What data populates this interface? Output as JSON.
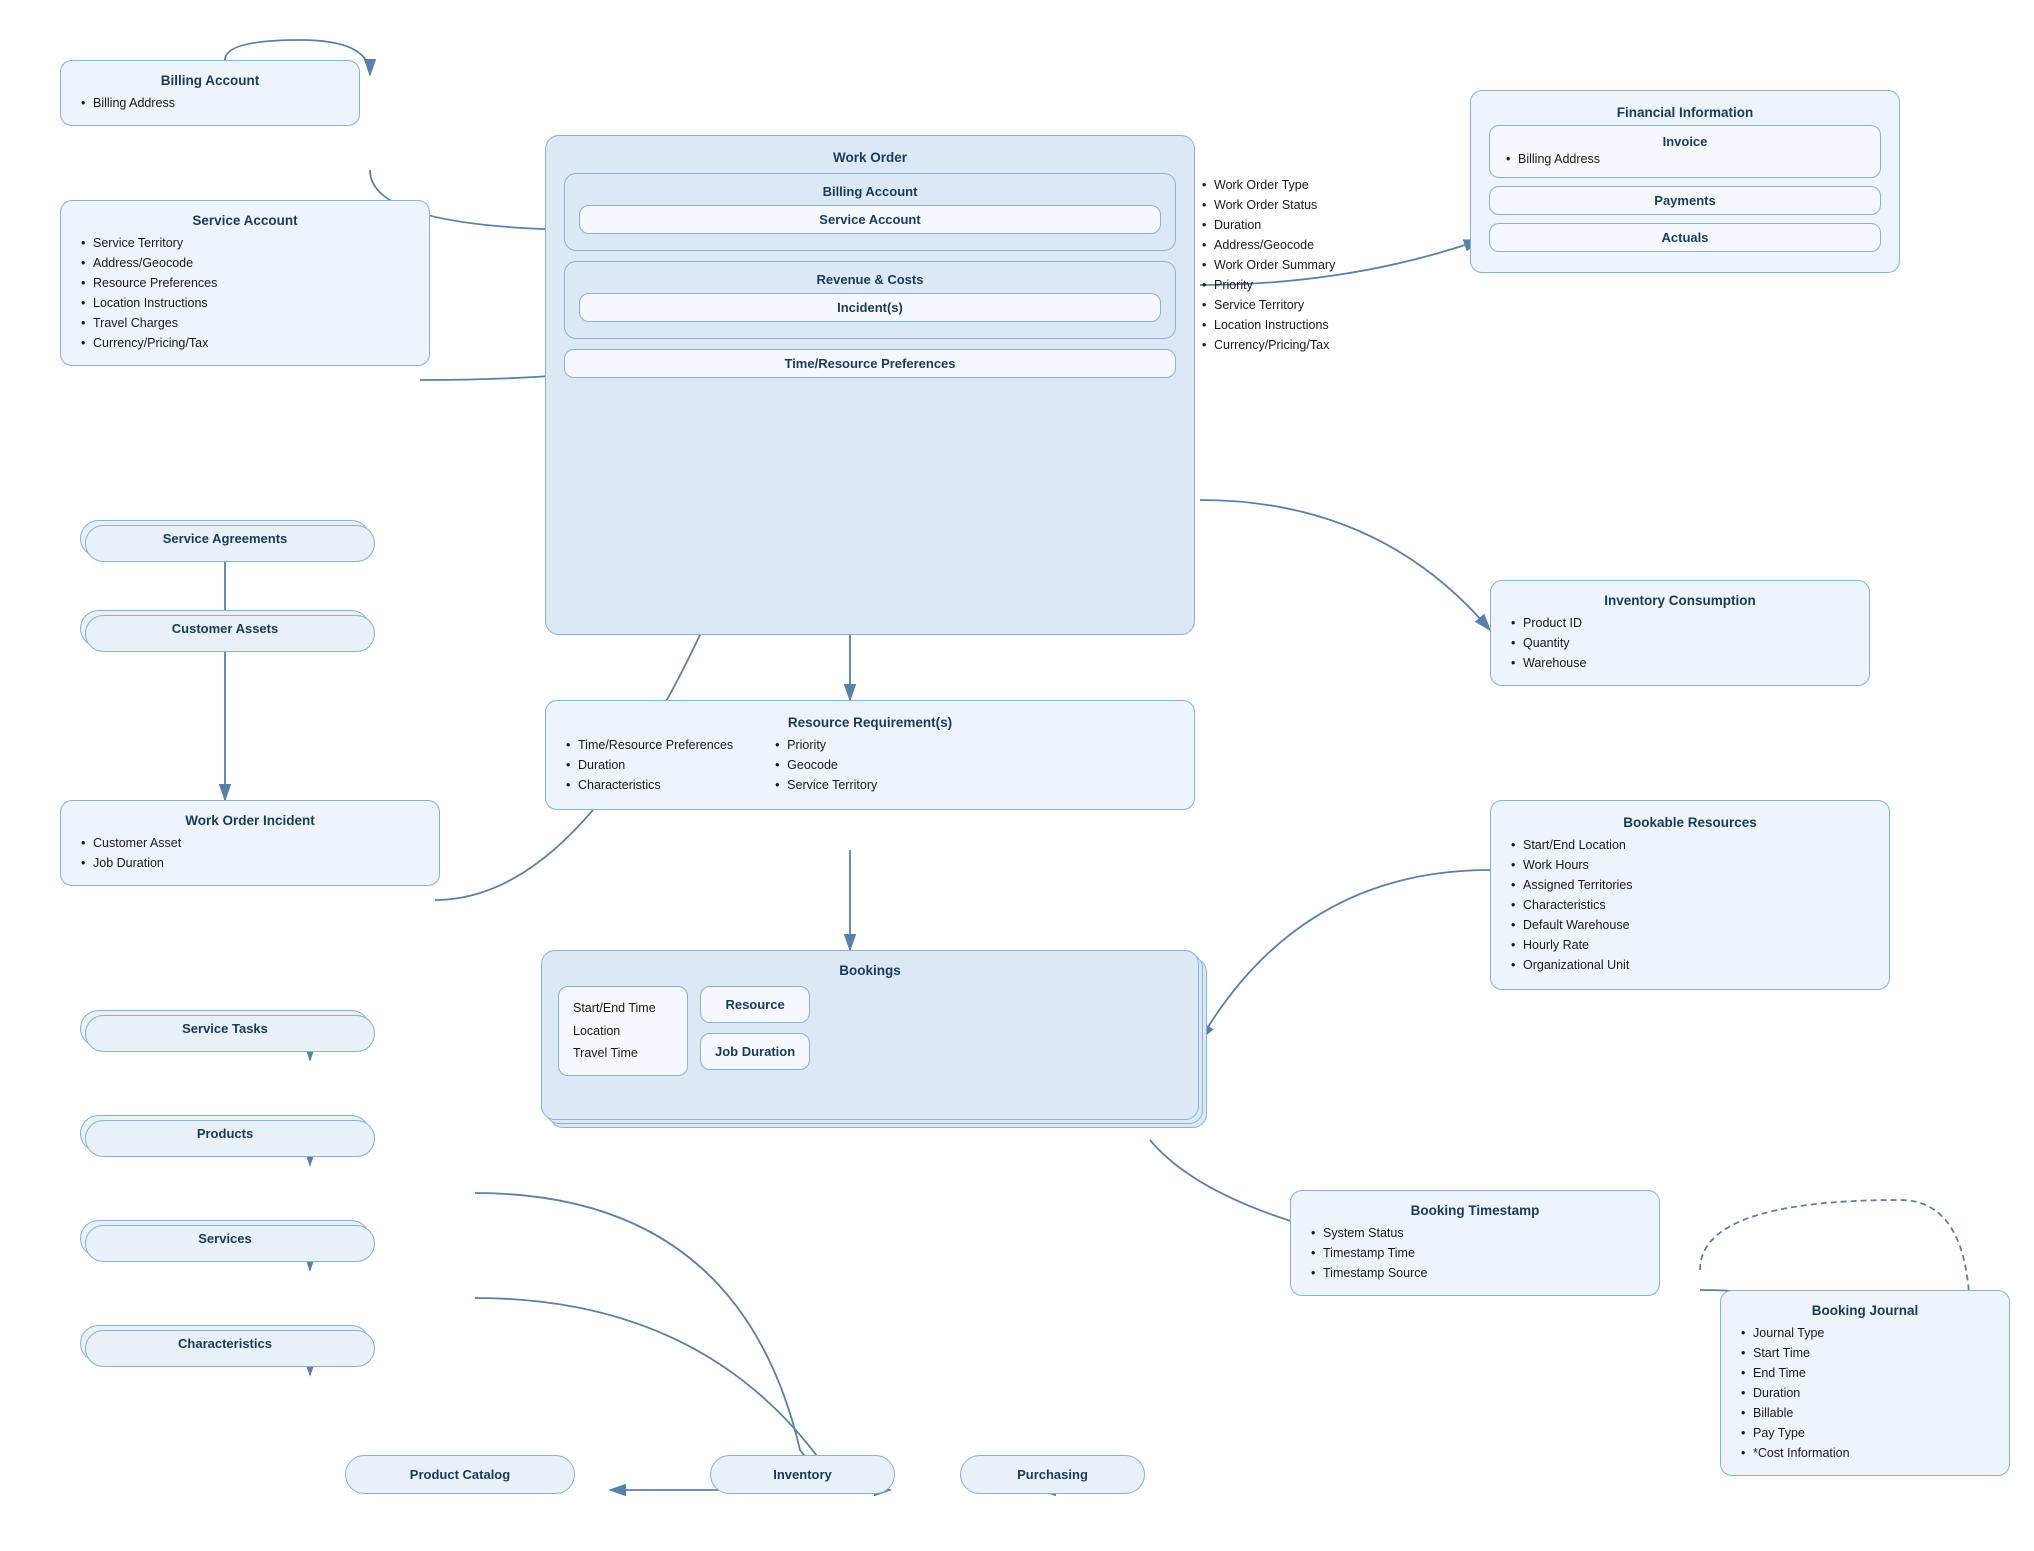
{
  "billing_account_top": {
    "title": "Billing Account",
    "items": [
      "Billing Address"
    ]
  },
  "service_account": {
    "title": "Service Account",
    "items": [
      "Service Territory",
      "Address/Geocode",
      "Resource Preferences",
      "Location Instructions",
      "Travel Charges",
      "Currency/Pricing/Tax"
    ]
  },
  "service_agreements": "Service Agreements",
  "customer_assets": "Customer Assets",
  "work_order_incident": {
    "title": "Work Order Incident",
    "items": [
      "Customer Asset",
      "Job Duration"
    ]
  },
  "service_tasks": "Service Tasks",
  "products": "Products",
  "services": "Services",
  "characteristics": "Characteristics",
  "product_catalog": "Product Catalog",
  "inventory": "Inventory",
  "purchasing": "Purchasing",
  "work_order_outer_title": "Work Order",
  "work_order_billing_account": "Billing Account",
  "work_order_service_account": "Service Account",
  "work_order_revenue_costs": "Revenue & Costs",
  "work_order_incidents": "Incident(s)",
  "work_order_time_resource": "Time/Resource Preferences",
  "work_order_fields": [
    "Work Order Type",
    "Work Order Status",
    "Duration",
    "Address/Geocode",
    "Work Order Summary",
    "Priority",
    "Service Territory",
    "Location Instructions",
    "Currency/Pricing/Tax"
  ],
  "resource_requirements": {
    "title": "Resource Requirement(s)",
    "col1": [
      "Time/Resource Preferences",
      "Duration",
      "Characteristics"
    ],
    "col2": [
      "Priority",
      "Geocode",
      "Service Territory"
    ]
  },
  "bookings": {
    "title": "Bookings",
    "left": [
      "Start/End Time",
      "Location",
      "Travel Time"
    ],
    "resource": "Resource",
    "job_duration": "Job Duration"
  },
  "financial_information": {
    "title": "Financial Information",
    "invoice_title": "Invoice",
    "invoice_items": [
      "Billing Address"
    ],
    "payments": "Payments",
    "actuals": "Actuals"
  },
  "inventory_consumption": {
    "title": "Inventory Consumption",
    "items": [
      "Product ID",
      "Quantity",
      "Warehouse"
    ]
  },
  "bookable_resources": {
    "title": "Bookable Resources",
    "items": [
      "Start/End Location",
      "Work Hours",
      "Assigned Territories",
      "Characteristics",
      "Default Warehouse",
      "Hourly Rate",
      "Organizational Unit"
    ]
  },
  "booking_timestamp": {
    "title": "Booking Timestamp",
    "items": [
      "System Status",
      "Timestamp Time",
      "Timestamp Source"
    ]
  },
  "booking_journal": {
    "title": "Booking Journal",
    "items": [
      "Journal Type",
      "Start Time",
      "End Time",
      "Duration",
      "Billable",
      "Pay Type",
      "*Cost Information"
    ]
  }
}
